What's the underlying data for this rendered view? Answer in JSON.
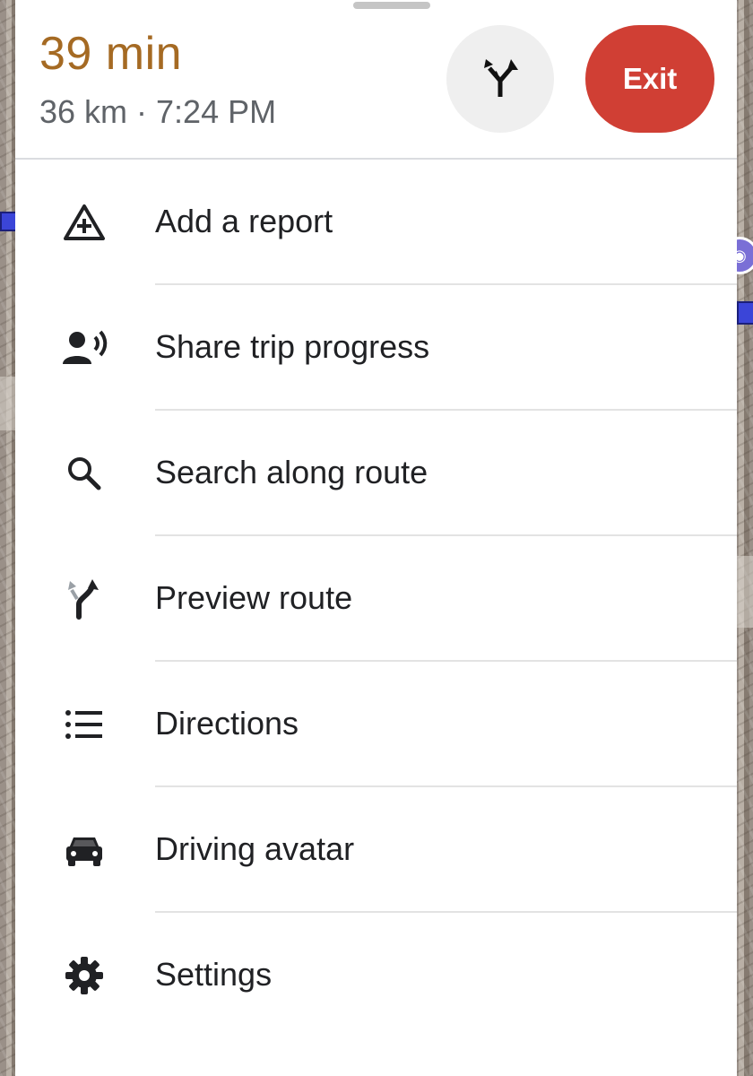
{
  "trip": {
    "eta_duration": "39 min",
    "eta_meta": "36 km · 7:24 PM",
    "exit_label": "Exit",
    "alt_route_icon": "alternate-routes-icon"
  },
  "menu": {
    "items": [
      {
        "label": "Add a report",
        "icon": "add-report-icon"
      },
      {
        "label": "Share trip progress",
        "icon": "share-trip-icon"
      },
      {
        "label": "Search along route",
        "icon": "search-icon"
      },
      {
        "label": "Preview route",
        "icon": "preview-route-icon"
      },
      {
        "label": "Directions",
        "icon": "list-icon"
      },
      {
        "label": "Driving avatar",
        "icon": "car-icon"
      },
      {
        "label": "Settings",
        "icon": "gear-icon"
      }
    ]
  },
  "colors": {
    "eta": "#a56a23",
    "exit_button": "#d03f34",
    "route_line": "#3b45d8"
  }
}
